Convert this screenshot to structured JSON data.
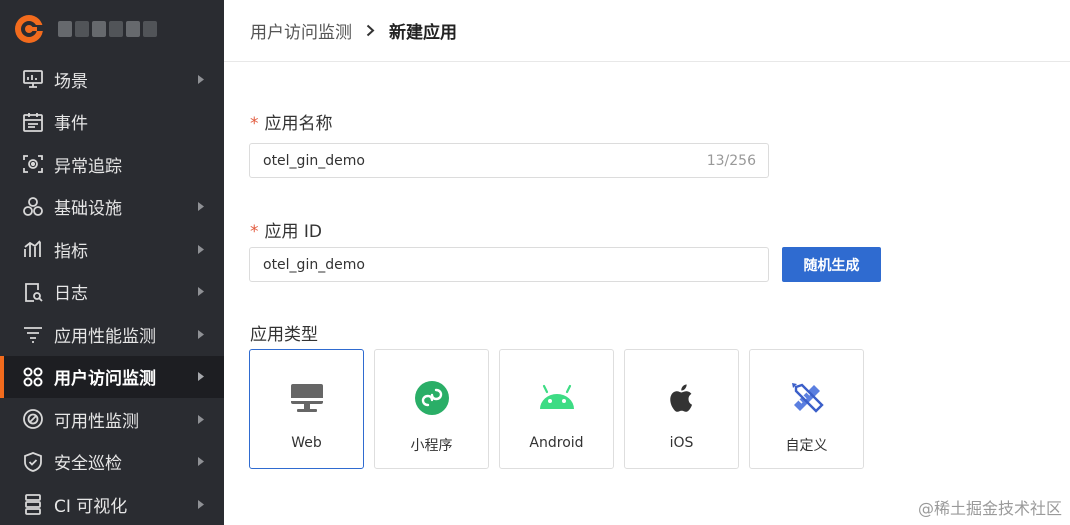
{
  "sidebar": {
    "logo": "gc-logo",
    "items": [
      {
        "label": "场景",
        "icon": "monitor-icon",
        "has_arrow": true
      },
      {
        "label": "事件",
        "icon": "calendar-icon",
        "has_arrow": false
      },
      {
        "label": "异常追踪",
        "icon": "scan-icon",
        "has_arrow": false
      },
      {
        "label": "基础设施",
        "icon": "hexagons-icon",
        "has_arrow": true
      },
      {
        "label": "指标",
        "icon": "bar-chart-icon",
        "has_arrow": true
      },
      {
        "label": "日志",
        "icon": "log-search-icon",
        "has_arrow": true
      },
      {
        "label": "应用性能监测",
        "icon": "filter-lines-icon",
        "has_arrow": true
      },
      {
        "label": "用户访问监测",
        "icon": "grid-circles-icon",
        "has_arrow": true,
        "active": true
      },
      {
        "label": "可用性监测",
        "icon": "circle-slash-icon",
        "has_arrow": true
      },
      {
        "label": "安全巡检",
        "icon": "shield-check-icon",
        "has_arrow": true
      },
      {
        "label": "CI 可视化",
        "icon": "stack-icon",
        "has_arrow": true
      }
    ],
    "active_accent": "#f26b1d"
  },
  "header": {
    "breadcrumb_parent": "用户访问监测",
    "breadcrumb_current": "新建应用"
  },
  "form": {
    "app_name": {
      "required_mark": "*",
      "label": "应用名称",
      "value": "otel_gin_demo",
      "counter": "13/256"
    },
    "app_id": {
      "required_mark": "*",
      "label": "应用 ID",
      "value": "otel_gin_demo",
      "generate_button": "随机生成"
    },
    "app_type": {
      "label": "应用类型",
      "options": [
        {
          "label": "Web",
          "icon": "monitor-icon",
          "selected": true
        },
        {
          "label": "小程序",
          "icon": "mini-program-icon",
          "selected": false
        },
        {
          "label": "Android",
          "icon": "android-icon",
          "selected": false
        },
        {
          "label": "iOS",
          "icon": "apple-icon",
          "selected": false
        },
        {
          "label": "自定义",
          "icon": "ruler-pencil-icon",
          "selected": false
        }
      ]
    }
  },
  "watermark": "@稀土掘金技术社区",
  "colors": {
    "primary": "#2f6bd0",
    "sidebar_bg": "#2a2c31",
    "required": "#e25c3f",
    "mini_program_green": "#2aae67",
    "android_green": "#3ddc84"
  }
}
